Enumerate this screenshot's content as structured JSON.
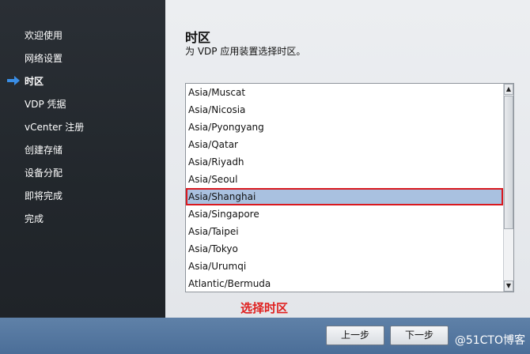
{
  "sidebar": {
    "items": [
      {
        "label": "欢迎使用",
        "active": false
      },
      {
        "label": "网络设置",
        "active": false
      },
      {
        "label": "时区",
        "active": true
      },
      {
        "label": "VDP 凭据",
        "active": false
      },
      {
        "label": "vCenter 注册",
        "active": false
      },
      {
        "label": "创建存储",
        "active": false
      },
      {
        "label": "设备分配",
        "active": false
      },
      {
        "label": "即将完成",
        "active": false
      },
      {
        "label": "完成",
        "active": false
      }
    ],
    "active_icon": "right-arrow-icon"
  },
  "main": {
    "title": "时区",
    "subtitle": "为 VDP 应用装置选择时区。",
    "timezones": [
      "Asia/Muscat",
      "Asia/Nicosia",
      "Asia/Pyongyang",
      "Asia/Qatar",
      "Asia/Riyadh",
      "Asia/Seoul",
      "Asia/Shanghai",
      "Asia/Singapore",
      "Asia/Taipei",
      "Asia/Tokyo",
      "Asia/Urumqi",
      "Atlantic/Bermuda"
    ],
    "selected": "Asia/Shanghai",
    "annotation": "选择时区"
  },
  "footer": {
    "back_label": "上一步",
    "next_label": "下一步",
    "watermark": "@51CTO博客"
  },
  "colors": {
    "sidebar_bg": "#2a2f35",
    "footer_bg": "#5f81a8",
    "selection_bg": "#a9c1e0",
    "highlight_red": "#d9191f",
    "arrow_blue": "#3a8ee6"
  }
}
